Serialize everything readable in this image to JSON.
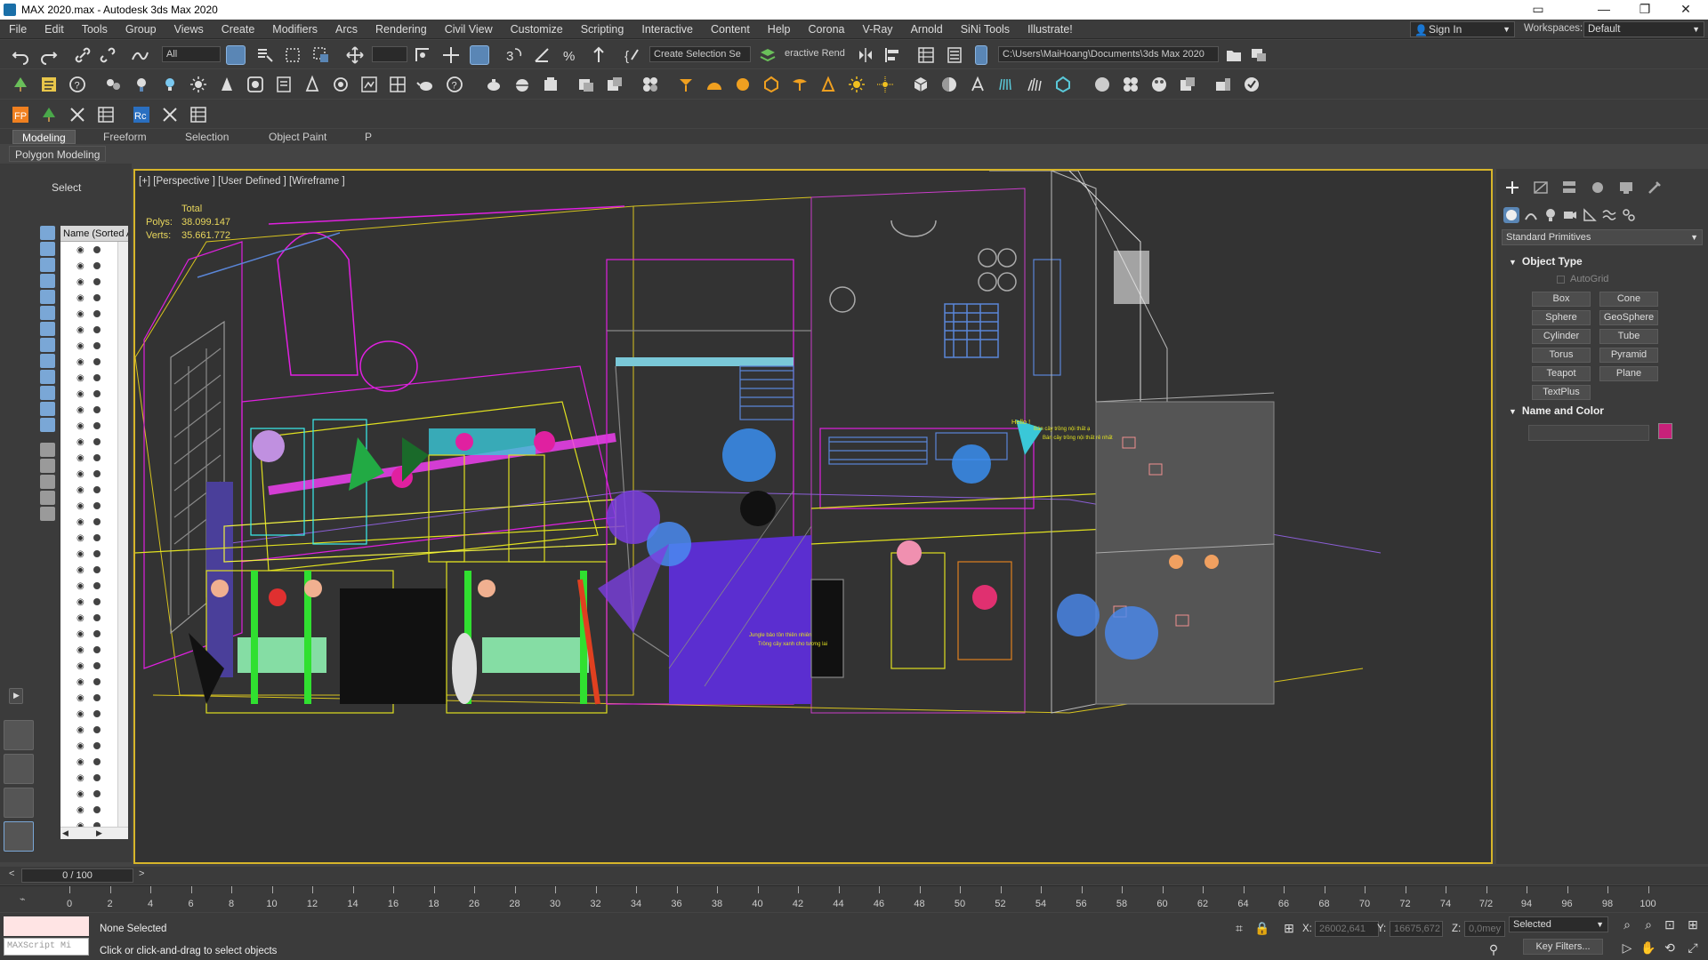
{
  "window": {
    "title": "MAX 2020.max - Autodesk 3ds Max 2020",
    "controls": [
      "▭",
      "—",
      "❐",
      "✕"
    ]
  },
  "menubar": {
    "items": [
      "File",
      "Edit",
      "Tools",
      "Group",
      "Views",
      "Create",
      "Modifiers",
      "Arcs",
      "Rendering",
      "Civil View",
      "Customize",
      "Scripting",
      "Interactive",
      "Content",
      "Help",
      "Corona",
      "V-Ray",
      "Arnold",
      "SiNi Tools",
      "Illustrate!"
    ],
    "sign_in": "Sign In",
    "workspaces_label": "Workspaces:",
    "workspace_value": "Default"
  },
  "toolbar": {
    "filter_value": "All",
    "selection_set": "Create Selection Se",
    "interactive_render": "eractive Rend",
    "project_path": "C:\\Users\\MaiHoang\\Documents\\3ds Max 2020"
  },
  "ribbon": {
    "tabs": [
      "Modeling",
      "Freeform",
      "Selection",
      "Object Paint",
      "P"
    ],
    "active_tab": "Modeling",
    "panel": "Polygon Modeling"
  },
  "scene_explorer": {
    "select_tab": "Select",
    "column_header": "Name (Sorted A"
  },
  "viewport": {
    "label": "[+] [Perspective ] [User Defined ] [Wireframe ]",
    "stats": {
      "total_label": "Total",
      "polys_label": "Polys:",
      "polys_value": "38.099.147",
      "verts_label": "Verts:",
      "verts_value": "35.661.772"
    },
    "scene_text": {
      "upper_right_1": "Hello !",
      "upper_right_2": "Bán cây trồng nội thất ạ",
      "upper_right_3": "Bán cây trồng nội thất rẻ nhất",
      "lower_center_1": "Jungle bảo tồn thiên nhiên",
      "lower_center_2": "Trồng cây xanh cho tương lai"
    }
  },
  "command_panel": {
    "category": "Standard Primitives",
    "object_type": {
      "title": "Object Type",
      "autogrid": "AutoGrid",
      "buttons": [
        "Box",
        "Cone",
        "Sphere",
        "GeoSphere",
        "Cylinder",
        "Tube",
        "Torus",
        "Pyramid",
        "Teapot",
        "Plane",
        "TextPlus"
      ]
    },
    "name_color": {
      "title": "Name and Color",
      "swatch": "#c8217a"
    }
  },
  "timeline": {
    "frame": "0 / 100",
    "ticks": [
      "0",
      "2",
      "4",
      "6",
      "8",
      "10",
      "12",
      "14",
      "16",
      "18",
      "26",
      "28",
      "30",
      "32",
      "34",
      "36",
      "38",
      "40",
      "42",
      "44",
      "46",
      "48",
      "50",
      "52",
      "54",
      "56",
      "58",
      "60",
      "62",
      "64",
      "66",
      "68",
      "70",
      "72",
      "74",
      "7/2",
      "94",
      "96",
      "98",
      "100"
    ]
  },
  "status": {
    "maxscript": "MAXScript Mi",
    "selection": "None Selected",
    "prompt": "Click or click-and-drag to select objects",
    "x_label": "X:",
    "x_value": "26002,641",
    "y_label": "Y:",
    "y_value": "16675,672",
    "z_label": "Z:",
    "z_value": "0,0mey",
    "key_mode": "Selected",
    "key_filters": "Key Filters..."
  }
}
